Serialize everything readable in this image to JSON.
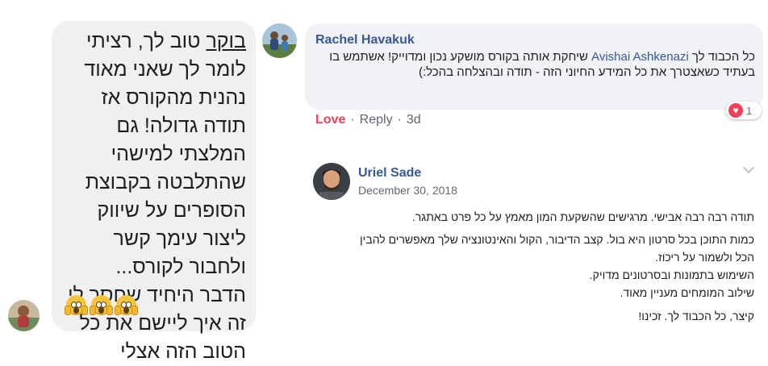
{
  "left_comment": {
    "first_word": "בוקר",
    "text_rest": " טוב לך, רציתי לומר לך שאני מאוד נהנית מהקורס אז תודה גדולה! גם המלצתי למישהי שהתלבטה בקבוצת הסופרים על שיווק ליצור עימך קשר ולחבור לקורס... הדבר היחיד שחסר לי זה איך ליישם את כל הטוב הזה  אצלי",
    "emojis": [
      "face-screaming-icon",
      "face-screaming-icon",
      "face-screaming-icon"
    ]
  },
  "rachel_comment": {
    "author": "Rachel Havakuk",
    "text_prefix": "כל הכבוד לך ",
    "mention": "Avishai Ashkenazi",
    "text_suffix": " שיחקת אותה בקורס מושקע נכון ומדוייק! אשתמש בו בעתיד כשאצטרך את כל המידע החיוני הזה - תודה ובהצלחה בהכל:)",
    "reaction_count": "1",
    "actions": {
      "love": "Love",
      "separator": "·",
      "reply": "Reply",
      "time": "3d"
    }
  },
  "uriel_comment": {
    "author": "Uriel Sade",
    "date": "December 30, 2018",
    "lines": [
      "תודה רבה רבה אבישי. מרגישים שהשקעת המון מאמץ על כל פרט באתגר.",
      "כמות התוכן בכל סרטון היא בול. קצב הדיבור, הקול והאינטונציה שלך מאפשרים להבין",
      "הכל ולשמור על ריכוז.",
      "השימוש בתמונות ובסרטונים מדויק.",
      "שילוב המומחים מעניין מאוד.",
      "קיצר, כל הכבוד לך. זכינו!"
    ]
  },
  "colors": {
    "link": "#385898",
    "love": "#f33e58",
    "bubble_bg": "#f0f2f5"
  }
}
